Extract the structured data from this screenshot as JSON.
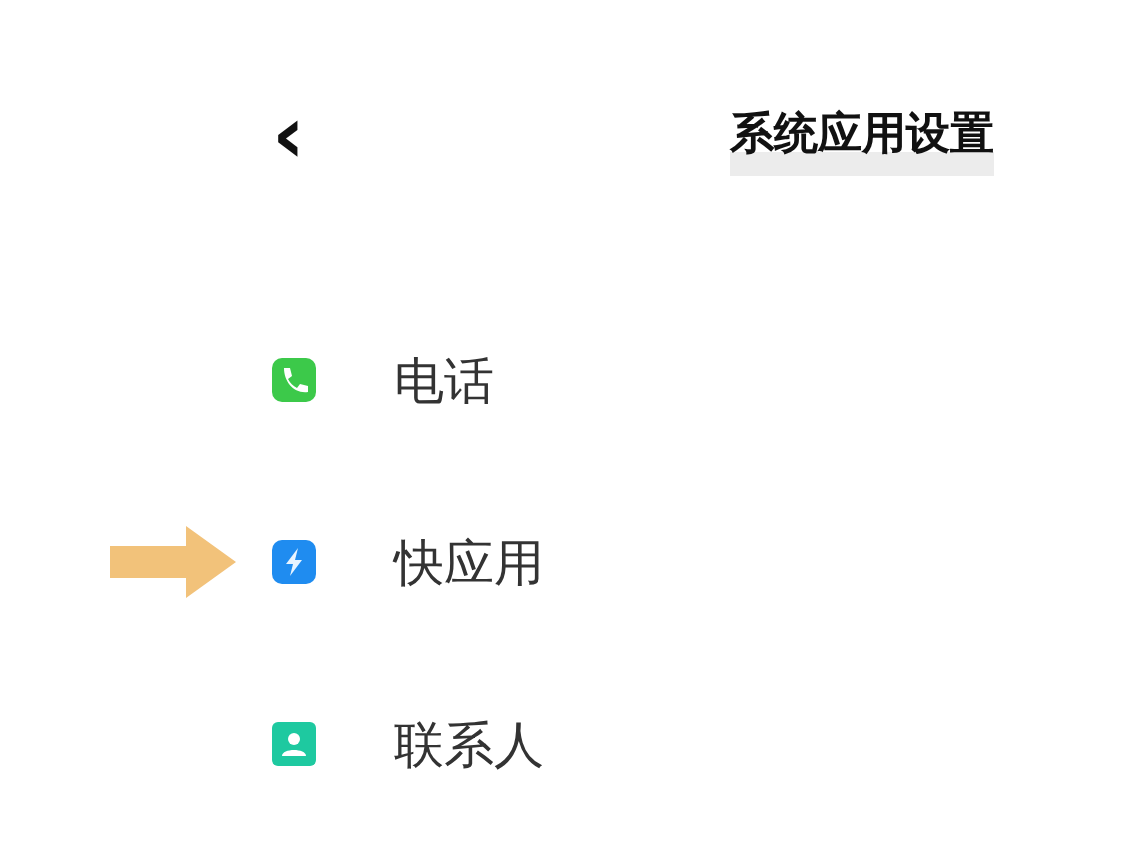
{
  "header": {
    "back": "‹",
    "title": "系统应用设置"
  },
  "items": [
    {
      "kind": "phone",
      "label": "电话",
      "pointed": false
    },
    {
      "kind": "quick",
      "label": "快应用",
      "pointed": true
    },
    {
      "kind": "contact",
      "label": "联系人",
      "pointed": false
    }
  ]
}
